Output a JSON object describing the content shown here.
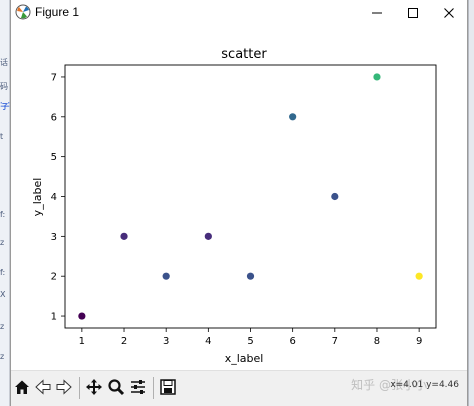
{
  "window": {
    "title": "Figure 1",
    "min_glyph": "—",
    "max_glyph": "☐",
    "close_glyph": "✕"
  },
  "background_strip_glyphs": [
    "话",
    "码",
    "字",
    "t",
    "f:",
    "z",
    "f:",
    "X",
    "z",
    "z"
  ],
  "chart_data": {
    "type": "scatter",
    "title": "scatter",
    "xlabel": "x_label",
    "ylabel": "y_label",
    "x": [
      1,
      2,
      3,
      4,
      5,
      6,
      7,
      8,
      9
    ],
    "y": [
      1,
      3,
      2,
      3,
      2,
      6,
      4,
      7,
      2
    ],
    "point_colors": [
      "#440154",
      "#472d7b",
      "#3b528b",
      "#472d7b",
      "#3b528b",
      "#31688e",
      "#3b528b",
      "#35b779",
      "#fde725"
    ],
    "xlim": [
      0.6,
      9.4
    ],
    "ylim": [
      0.7,
      7.3
    ],
    "xticks": [
      1,
      2,
      3,
      4,
      5,
      6,
      7,
      8,
      9
    ],
    "yticks": [
      1,
      2,
      3,
      4,
      5,
      6,
      7
    ],
    "grid": false,
    "legend": false
  },
  "toolbar": {
    "icons": [
      "home-icon",
      "back-arrow-icon",
      "forward-arrow-icon",
      "pan-icon",
      "zoom-icon",
      "configure-subplots-icon",
      "save-icon"
    ],
    "coords_text": "x=4.01 y=4.46"
  },
  "watermark": "知乎 @张小小"
}
